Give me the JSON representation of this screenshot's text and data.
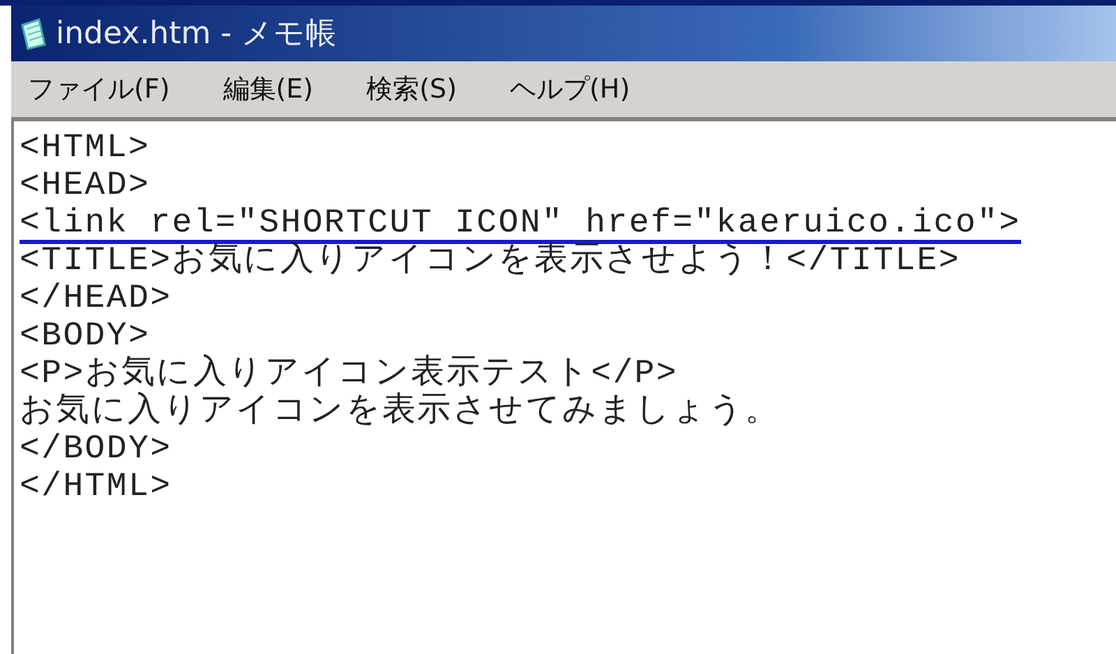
{
  "window": {
    "title": "index.htm - メモ帳"
  },
  "menu": [
    "ファイル(F)",
    "編集(E)",
    "検索(S)",
    "ヘルプ(H)"
  ],
  "lines": [
    {
      "text": "<HTML>",
      "highlighted": false
    },
    {
      "text": "<HEAD>",
      "highlighted": false
    },
    {
      "text": "<link rel=\"SHORTCUT ICON\" href=\"kaeruico.ico\">",
      "highlighted": true
    },
    {
      "text": "<TITLE>お気に入りアイコンを表示させよう！</TITLE>",
      "highlighted": false
    },
    {
      "text": "</HEAD>",
      "highlighted": false
    },
    {
      "text": "<BODY>",
      "highlighted": false
    },
    {
      "text": "<P>お気に入りアイコン表示テスト</P>",
      "highlighted": false
    },
    {
      "text": "お気に入りアイコンを表示させてみましょう。",
      "highlighted": false
    },
    {
      "text": "</BODY>",
      "highlighted": false
    },
    {
      "text": "</HTML>",
      "highlighted": false
    }
  ]
}
